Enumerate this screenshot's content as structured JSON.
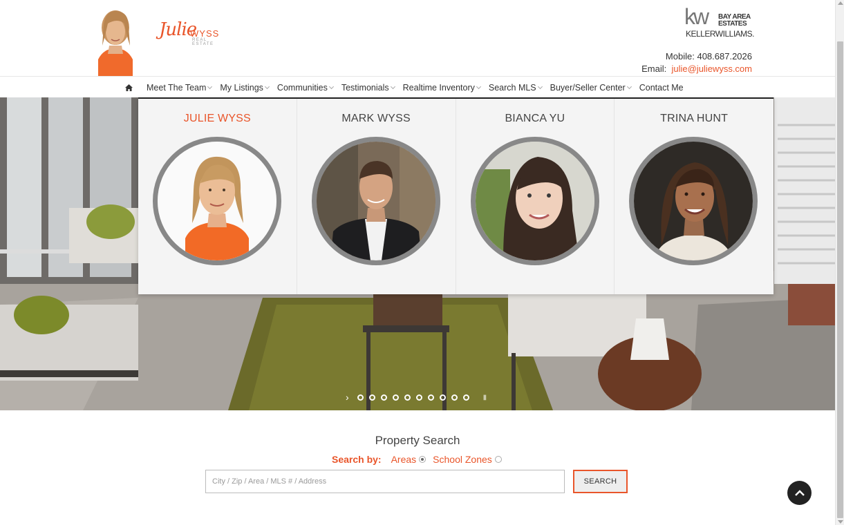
{
  "header": {
    "logo": {
      "script": "Julie",
      "name": "WYSS",
      "tagline": "REAL ESTATE"
    },
    "brokerage": {
      "kw": "kw",
      "line1": "BAY AREA",
      "line2": "ESTATES",
      "name": "KELLERWILLIAMS."
    },
    "contact": {
      "mobile_label": "Mobile:",
      "mobile": "408.687.2026",
      "email_label": "Email:",
      "email": "julie@juliewyss.com"
    }
  },
  "nav": {
    "home_icon": "home-icon",
    "items": [
      {
        "label": "Meet The Team",
        "has_dropdown": true
      },
      {
        "label": "My Listings",
        "has_dropdown": true
      },
      {
        "label": "Communities",
        "has_dropdown": true
      },
      {
        "label": "Testimonials",
        "has_dropdown": true
      },
      {
        "label": "Realtime Inventory",
        "has_dropdown": true
      },
      {
        "label": "Search MLS",
        "has_dropdown": true
      },
      {
        "label": "Buyer/Seller Center",
        "has_dropdown": true
      },
      {
        "label": "Contact Me",
        "has_dropdown": false
      }
    ]
  },
  "team_dropdown": {
    "members": [
      {
        "name": "JULIE WYSS",
        "active": true
      },
      {
        "name": "MARK WYSS",
        "active": false
      },
      {
        "name": "BIANCA YU",
        "active": false
      },
      {
        "name": "TRINA HUNT",
        "active": false
      }
    ]
  },
  "slider": {
    "dot_count": 10
  },
  "search": {
    "title": "Property Search",
    "search_by_label": "Search by:",
    "options": [
      {
        "label": "Areas",
        "selected": true
      },
      {
        "label": "School Zones",
        "selected": false
      }
    ],
    "placeholder": "City / Zip / Area / MLS # / Address",
    "button_label": "SEARCH"
  },
  "colors": {
    "accent": "#e9552a",
    "text": "#333333",
    "dropdown_bg": "#f4f4f4"
  }
}
